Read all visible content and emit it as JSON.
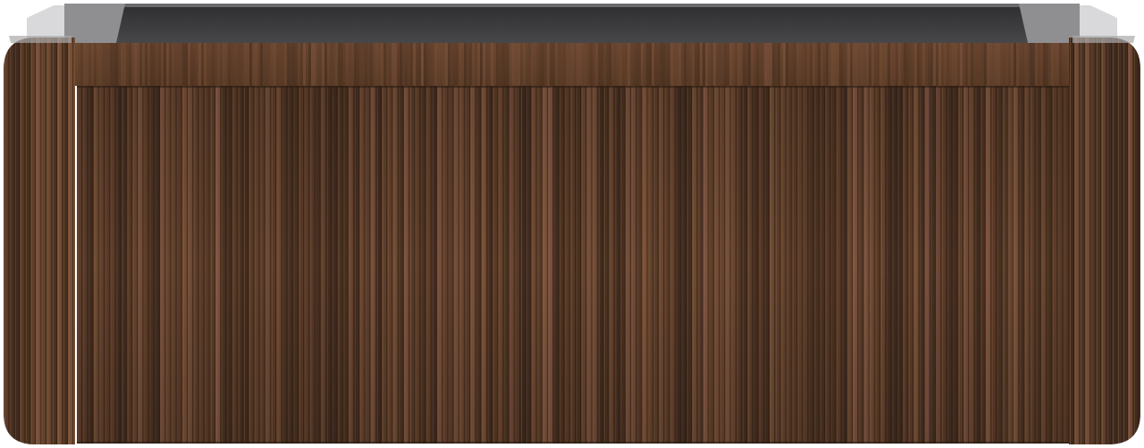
{
  "product": {
    "subject": "wall-hung-vanity-cabinet",
    "finish": "fluted-walnut",
    "colors": {
      "background": "#ffffff",
      "wood_dark": "#3f2a1e",
      "wood_mid": "#5a3b28",
      "wood_light": "#7a5238",
      "groove": "#2b1b12",
      "interior": "#3a3a3c",
      "interior_top": "#4a4a4d",
      "metal_edge": "#9a9a9c"
    }
  }
}
